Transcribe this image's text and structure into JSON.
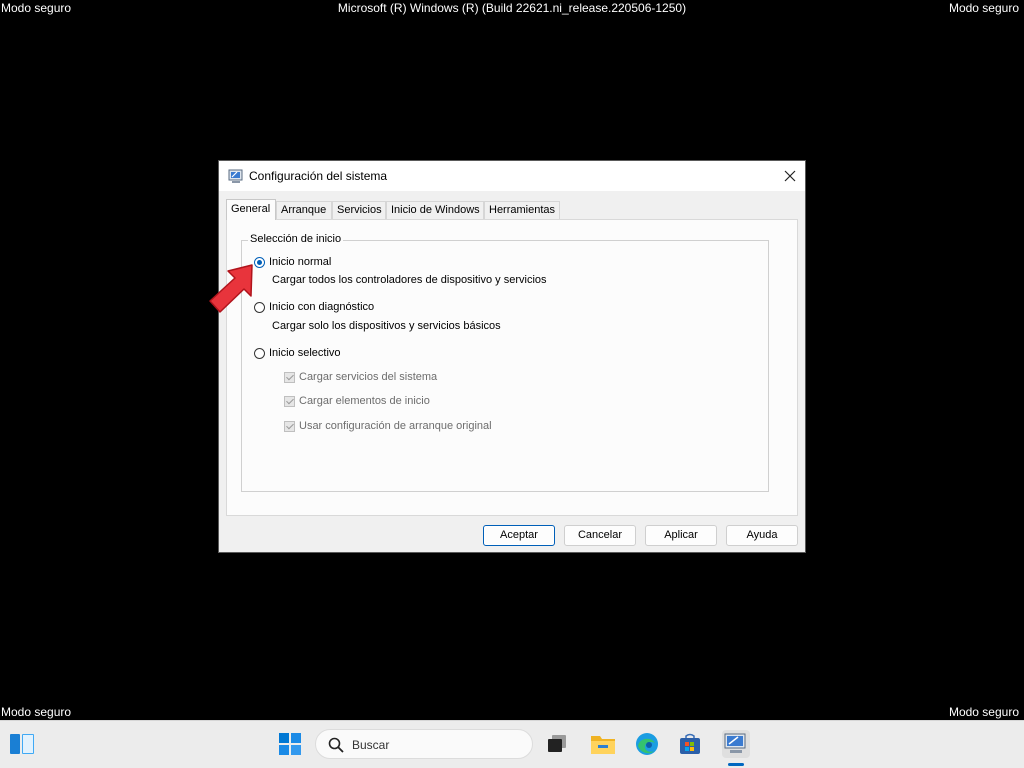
{
  "overlay": {
    "corner_label": "Modo seguro",
    "build_text": "Microsoft (R) Windows (R) (Build 22621.ni_release.220506-1250)"
  },
  "dialog": {
    "title": "Configuración del sistema",
    "tabs": [
      "General",
      "Arranque",
      "Servicios",
      "Inicio de Windows",
      "Herramientas"
    ],
    "active_tab": "General",
    "group_label": "Selección de inicio",
    "options": [
      {
        "label": "Inicio normal",
        "description": "Cargar todos los controladores de dispositivo y servicios",
        "selected": true
      },
      {
        "label": "Inicio con diagnóstico",
        "description": "Cargar solo los dispositivos y servicios básicos",
        "selected": false
      },
      {
        "label": "Inicio selectivo",
        "selected": false
      }
    ],
    "selective_checks": [
      {
        "label": "Cargar servicios del sistema",
        "checked": true,
        "disabled": true
      },
      {
        "label": "Cargar elementos de inicio",
        "checked": true,
        "disabled": true
      },
      {
        "label": "Usar configuración de arranque original",
        "checked": true,
        "disabled": true
      }
    ],
    "buttons": {
      "ok": "Aceptar",
      "cancel": "Cancelar",
      "apply": "Aplicar",
      "help": "Ayuda"
    }
  },
  "taskbar": {
    "search_placeholder": "Buscar",
    "icons": [
      "widgets-icon",
      "start-icon",
      "search-icon",
      "task-view-icon",
      "file-explorer-icon",
      "edge-icon",
      "store-icon",
      "msconfig-icon"
    ]
  },
  "colors": {
    "accent": "#005fb8",
    "arrow": "#e8343c",
    "background": "#000000",
    "dialog": "#f0f0f0"
  }
}
